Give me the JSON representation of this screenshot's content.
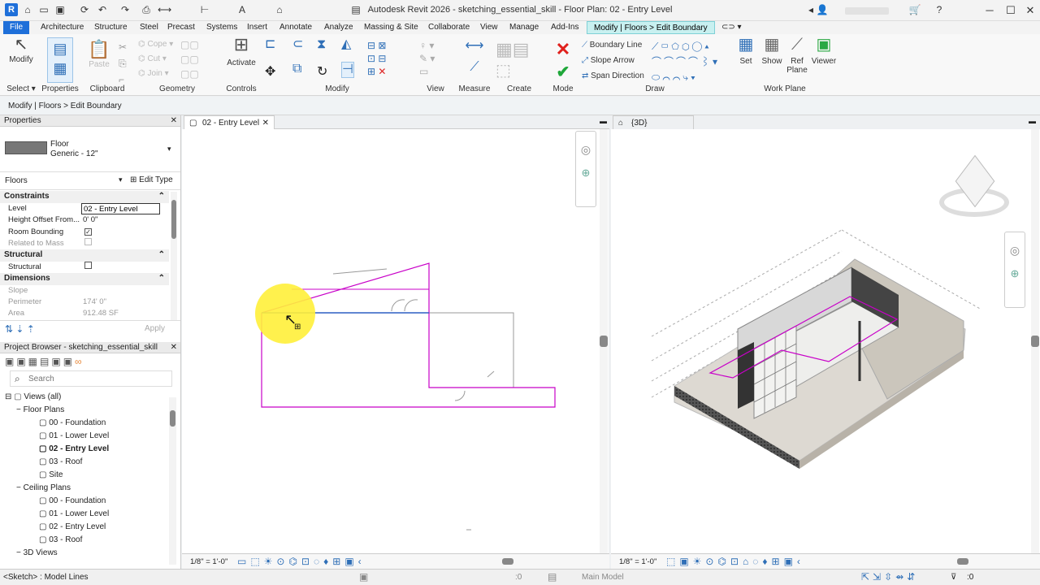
{
  "app": {
    "title": "Autodesk Revit 2026 - sketching_essential_skill - Floor Plan: 02 - Entry Level",
    "logo": "R"
  },
  "tabs": [
    "File",
    "Architecture",
    "Structure",
    "Steel",
    "Precast",
    "Systems",
    "Insert",
    "Annotate",
    "Analyze",
    "Massing & Site",
    "Collaborate",
    "View",
    "Manage",
    "Add-Ins",
    "Modify | Floors > Edit Boundary"
  ],
  "ribbon": {
    "modify_label": "Modify",
    "properties_label": "Properties",
    "activate_label": "Activate",
    "faded": {
      "paste": "Paste",
      "cope": "Cope",
      "cut": "Cut",
      "join": "Join"
    },
    "draw_items": {
      "boundary_line": "Boundary Line",
      "slope_arrow": "Slope Arrow",
      "span_direction": "Span Direction"
    },
    "workplane": {
      "set": "Set",
      "show": "Show",
      "ref_plane": "Ref\nPlane",
      "viewer": "Viewer"
    },
    "panels": {
      "select": "Select",
      "properties": "Properties",
      "clipboard": "Clipboard",
      "geometry": "Geometry",
      "controls": "Controls",
      "modify": "Modify",
      "view": "View",
      "measure": "Measure",
      "create": "Create",
      "mode": "Mode",
      "draw": "Draw",
      "work_plane": "Work Plane"
    }
  },
  "option_bar": {
    "breadcrumb": "Modify | Floors > Edit Boundary"
  },
  "properties": {
    "title": "Properties",
    "type_name": "Floor",
    "type_sub": "Generic - 12\"",
    "filter": "Floors",
    "edit_type": "Edit Type",
    "constraints": "Constraints",
    "level_k": "Level",
    "level_v": "02 - Entry Level",
    "height_k": "Height Offset From...",
    "height_v": "0'  0\"",
    "room_k": "Room Bounding",
    "mass_k": "Related to Mass",
    "structural_sect": "Structural",
    "structural_k": "Structural",
    "dimensions": "Dimensions",
    "slope_k": "Slope",
    "perimeter_k": "Perimeter",
    "perimeter_v": "174'  0\"",
    "area_k": "Area",
    "area_v": "912.48 SF",
    "apply": "Apply"
  },
  "browser": {
    "title": "Project Browser - sketching_essential_skill",
    "search_placeholder": "Search",
    "views_all": "Views (all)",
    "floor_plans": "Floor Plans",
    "fp": [
      "00 - Foundation",
      "01 - Lower Level",
      "02 - Entry Level",
      "03 - Roof",
      "Site"
    ],
    "ceiling_plans": "Ceiling Plans",
    "cp": [
      "00 - Foundation",
      "01 - Lower Level",
      "02 - Entry Level",
      "03 - Roof"
    ],
    "views_3d": "3D Views"
  },
  "views": {
    "plan_tab": "02 - Entry Level",
    "tab_3d": "{3D}",
    "scale1": "1/8\" = 1'-0\"",
    "scale2": "1/8\" = 1'-0\""
  },
  "status": {
    "left": "<Sketch> : Model Lines",
    "model": "Main Model",
    "zero1": ":0",
    "zero2": ":0"
  },
  "colors": {
    "accent": "#1e6fd9",
    "sketch": "#c800c8",
    "highlight": "#ffef3a"
  }
}
